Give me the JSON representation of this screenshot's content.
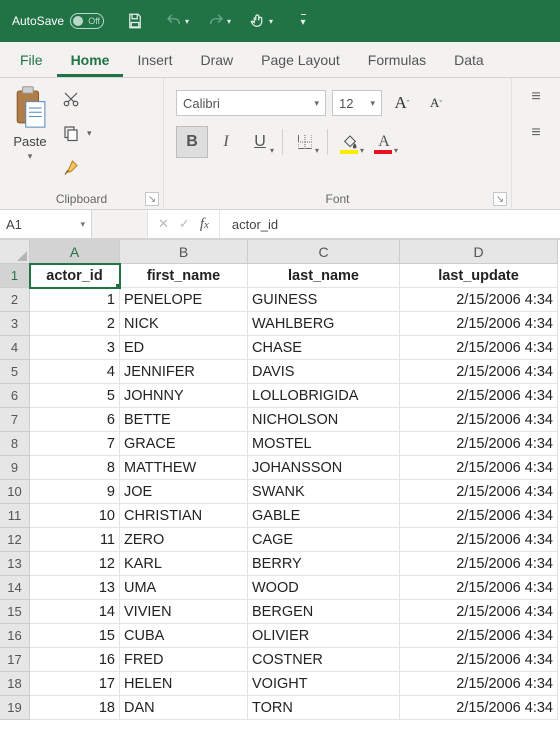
{
  "titlebar": {
    "autosave_label": "AutoSave",
    "autosave_state": "Off"
  },
  "tabs": {
    "file": "File",
    "home": "Home",
    "insert": "Insert",
    "draw": "Draw",
    "page_layout": "Page Layout",
    "formulas": "Formulas",
    "data": "Data"
  },
  "ribbon": {
    "clipboard": {
      "label": "Clipboard",
      "paste": "Paste"
    },
    "font": {
      "label": "Font",
      "font_name": "Calibri",
      "font_size": "12",
      "bold": "B",
      "italic": "I",
      "underline": "U",
      "fontcolor_letter": "A",
      "grow": "A",
      "shrink": "A"
    }
  },
  "namebox": "A1",
  "formula_value": "actor_id",
  "columns": [
    "A",
    "B",
    "C",
    "D"
  ],
  "headers": {
    "A": "actor_id",
    "B": "first_name",
    "C": "last_name",
    "D": "last_update"
  },
  "rows": [
    {
      "n": 1,
      "A": "actor_id",
      "B": "first_name",
      "C": "last_name",
      "D": "last_update"
    },
    {
      "n": 2,
      "A": "1",
      "B": "PENELOPE",
      "C": "GUINESS",
      "D": "2/15/2006 4:34"
    },
    {
      "n": 3,
      "A": "2",
      "B": "NICK",
      "C": "WAHLBERG",
      "D": "2/15/2006 4:34"
    },
    {
      "n": 4,
      "A": "3",
      "B": "ED",
      "C": "CHASE",
      "D": "2/15/2006 4:34"
    },
    {
      "n": 5,
      "A": "4",
      "B": "JENNIFER",
      "C": "DAVIS",
      "D": "2/15/2006 4:34"
    },
    {
      "n": 6,
      "A": "5",
      "B": "JOHNNY",
      "C": "LOLLOBRIGIDA",
      "D": "2/15/2006 4:34"
    },
    {
      "n": 7,
      "A": "6",
      "B": "BETTE",
      "C": "NICHOLSON",
      "D": "2/15/2006 4:34"
    },
    {
      "n": 8,
      "A": "7",
      "B": "GRACE",
      "C": "MOSTEL",
      "D": "2/15/2006 4:34"
    },
    {
      "n": 9,
      "A": "8",
      "B": "MATTHEW",
      "C": "JOHANSSON",
      "D": "2/15/2006 4:34"
    },
    {
      "n": 10,
      "A": "9",
      "B": "JOE",
      "C": "SWANK",
      "D": "2/15/2006 4:34"
    },
    {
      "n": 11,
      "A": "10",
      "B": "CHRISTIAN",
      "C": "GABLE",
      "D": "2/15/2006 4:34"
    },
    {
      "n": 12,
      "A": "11",
      "B": "ZERO",
      "C": "CAGE",
      "D": "2/15/2006 4:34"
    },
    {
      "n": 13,
      "A": "12",
      "B": "KARL",
      "C": "BERRY",
      "D": "2/15/2006 4:34"
    },
    {
      "n": 14,
      "A": "13",
      "B": "UMA",
      "C": "WOOD",
      "D": "2/15/2006 4:34"
    },
    {
      "n": 15,
      "A": "14",
      "B": "VIVIEN",
      "C": "BERGEN",
      "D": "2/15/2006 4:34"
    },
    {
      "n": 16,
      "A": "15",
      "B": "CUBA",
      "C": "OLIVIER",
      "D": "2/15/2006 4:34"
    },
    {
      "n": 17,
      "A": "16",
      "B": "FRED",
      "C": "COSTNER",
      "D": "2/15/2006 4:34"
    },
    {
      "n": 18,
      "A": "17",
      "B": "HELEN",
      "C": "VOIGHT",
      "D": "2/15/2006 4:34"
    },
    {
      "n": 19,
      "A": "18",
      "B": "DAN",
      "C": "TORN",
      "D": "2/15/2006 4:34"
    }
  ]
}
